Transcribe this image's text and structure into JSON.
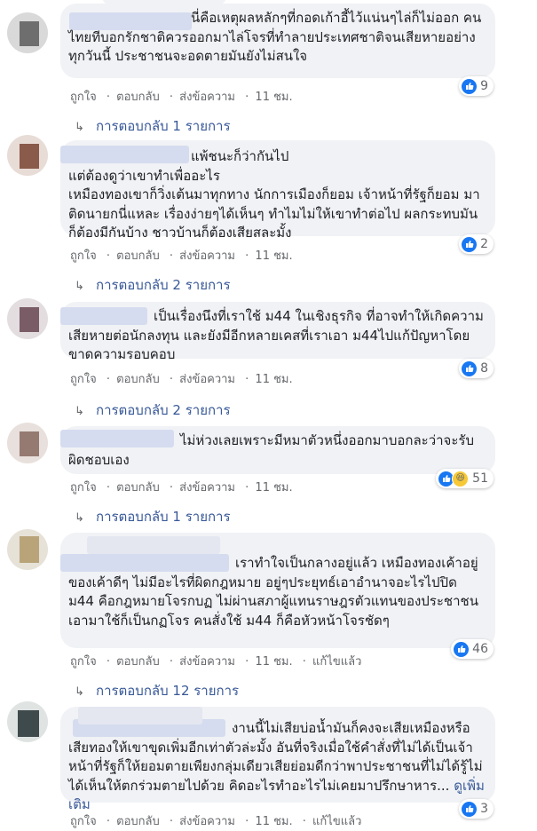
{
  "actions": {
    "like": "ถูกใจ",
    "reply": "ตอบกลับ",
    "message": "ส่งข้อความ",
    "edited": "แก้ไขแล้ว",
    "separator": "·"
  },
  "comments": [
    {
      "text": "นี่คือเหตุผลหลักๆที่กอดเก้าอี้ไว้แน่นๆไล่ก็ไม่ออก คนไทยทีบอกรักชาติควรออกมาไล่โจรที่ทำลายประเทศชาติจนเสียหายอย่างทุกวันนี้ ประชาชนจะอดตายมันยังไม่สนใจ",
      "time": "11 ชม.",
      "reactions": "9",
      "replies": "การตอบกลับ 1 รายการ"
    },
    {
      "text": "แพ้ชนะก็ว่ากันไป\nแต่ต้องดูว่าเขาทำเพื่ออะไร\nเหมืองทองเขาก็วิ่งเต้นมาทุกทาง นักการเมืองก็ยอม เจ้าหน้าที่รัฐก็ยอม มาติดนายกนี่แหละ เรื่องง่ายๆได้เห็นๆ ทำไมไม่ให้เขาทำต่อไป ผลกระทบมันก็ต้องมีกันบ้าง ชาวบ้านก็ต้องเสียสละมั้ง",
      "time": "11 ชม.",
      "reactions": "2",
      "replies": "การตอบกลับ 2 รายการ"
    },
    {
      "text": "เป็นเรื่องนึงที่เราใช้ ม44 ในเชิงธุรกิจ ที่อาจทำให้เกิดความเสียหายต่อนักลงทุน และยังมีอีกหลายเคสที่เราเอา ม44ไปแก้ปัญหาโดยขาดความรอบคอบ",
      "time": "11 ชม.",
      "reactions": "8",
      "replies": "การตอบกลับ 2 รายการ"
    },
    {
      "text": "ไม่ห่วงเลยเพราะมีหมาตัวหนึ่งออกมาบอกละว่าจะรับผิดชอบเอง",
      "time": "11 ชม.",
      "reactions": "51",
      "replies": "การตอบกลับ 1 รายการ"
    },
    {
      "text": "เราทำใจเป็นกลางอยู่แล้ว เหมืองทองเค้าอยู่ของเค้าดีๆ ไม่มีอะไรที่ผิดกฎหมาย อยู่ๆประยุทธ์เอาอำนาจอะไรไปปิด ม44 คือกฎหมายโจรกบฏ ไม่ผ่านสภาผู้แทนราษฎรตัวแทนของประชาชน เอามาใช้ก็เป็นกฏโจร คนสั่งใช้ ม44 ก็คือหัวหน้าโจรชัดๆ",
      "time": "11 ชม.",
      "reactions": "46",
      "replies": "การตอบกลับ 12 รายการ"
    },
    {
      "text": "งานนี้ไม่เสียบ่อน้ำมันก็คงจะเสียเหมืองหรือเสียทองให้เขาขุดเพิ่มอีกเท่าตัวล่ะมั้ง อันที่จริงเมื่อใช้คำสั่งที่ไม่ได้เป็นเจ้าหน้าที่รัฐก็ให้ยอมตายเพียงกลุ่มเดียวเสียย่อมดีกว่าพาประชาชนที่ไม่ได้รู้ไม่ได้เห็นให้ตกร่วมตายไปด้วย คิดอะไรทำอะไรไม่เคยมาปรึกษาหาร...",
      "see_more": "ดูเพิ่มเติม",
      "time": "11 ชม.",
      "reactions": "3"
    }
  ]
}
